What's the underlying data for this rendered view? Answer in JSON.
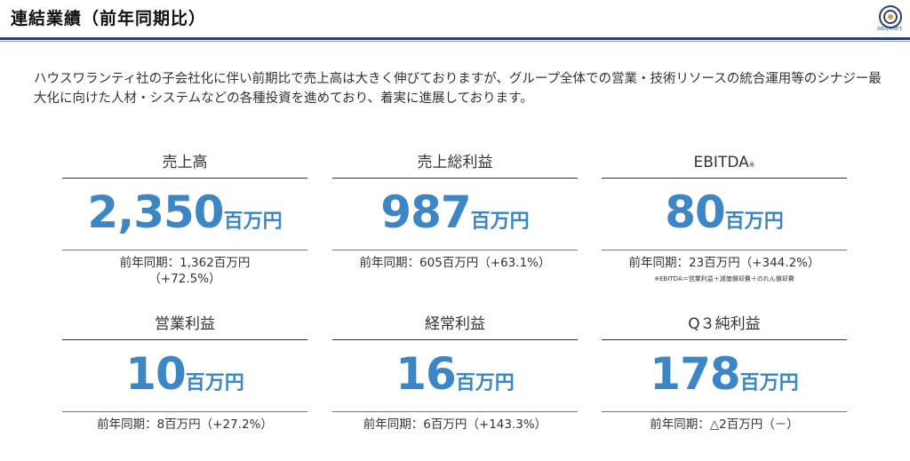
{
  "header": {
    "title": "連結業績（前年同期比）",
    "logo_text": "JIBANNET"
  },
  "intro": "ハウスワランティ社の子会社化に伴い前期比で売上高は大きく伸びておりますが、グループ全体での営業・技術リソースの統合運用等のシナジー最大化に向けた人材・システムなどの各種投資を進めており、着実に進展しております。",
  "cards": [
    {
      "label": "売上高",
      "value": "2,350",
      "unit": "百万円",
      "prev_line1": "前年同期：1,362百万円",
      "prev_line2": "（+72.5%）"
    },
    {
      "label": "売上総利益",
      "value": "987",
      "unit": "百万円",
      "prev_line1": "前年同期：605百万円（+63.1%）"
    },
    {
      "label": "EBITDA",
      "label_mark": "※",
      "value": "80",
      "unit": "百万円",
      "prev_line1": "前年同期：23百万円（+344.2%）",
      "note": "※EBITDA＝営業利益＋減価償却費＋のれん償却費"
    },
    {
      "label": "営業利益",
      "value": "10",
      "unit": "百万円",
      "prev_line1": "前年同期：8百万円（+27.2%）"
    },
    {
      "label": "経常利益",
      "value": "16",
      "unit": "百万円",
      "prev_line1": "前年同期：6百万円（+143.3%）"
    },
    {
      "label": "Q３純利益",
      "value": "178",
      "unit": "百万円",
      "prev_line1": "前年同期：△2百万円（－）"
    }
  ],
  "colors": {
    "accent": "#3d86c6",
    "header_rule": "#2a3f7a"
  }
}
